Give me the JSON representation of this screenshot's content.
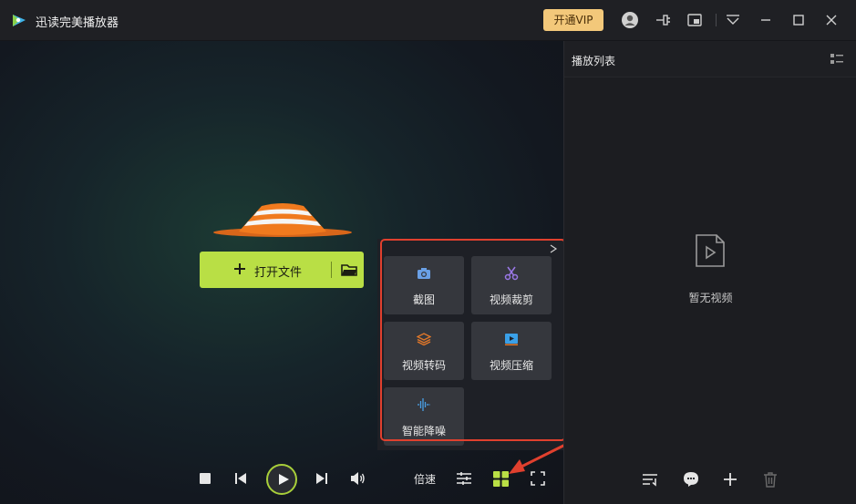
{
  "window": {
    "title": "迅读完美播放器",
    "vip_label": "开通VIP"
  },
  "player": {
    "open_file_label": "打开文件",
    "speed_label": "倍速"
  },
  "tools": [
    {
      "label": "截图",
      "icon": "camera-icon",
      "color": "#6aa0e6"
    },
    {
      "label": "视频裁剪",
      "icon": "scissors-icon",
      "color": "#9a78e6"
    },
    {
      "label": "视频转码",
      "icon": "layers-icon",
      "color": "#e0772a"
    },
    {
      "label": "视频压缩",
      "icon": "video-compress-icon",
      "color": "#3aa0e8"
    },
    {
      "label": "智能降噪",
      "icon": "waveform-icon",
      "color": "#4aa0e6"
    }
  ],
  "playlist": {
    "title": "播放列表",
    "empty_text": "暂无视频"
  },
  "colors": {
    "accent": "#b9df45",
    "vip": "#f3c87a",
    "highlight_box": "#e0402e"
  }
}
